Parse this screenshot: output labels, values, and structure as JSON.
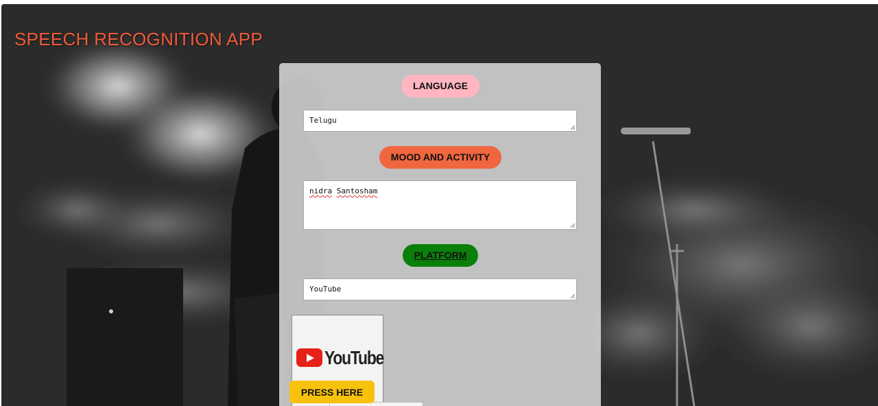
{
  "header": {
    "title": "SPEECH RECOGNITION APP"
  },
  "form": {
    "language_label": "LANGUAGE",
    "language_value": "Telugu",
    "mood_label": "MOOD AND ACTIVITY",
    "mood_value_words": [
      "nidra",
      "Santosham"
    ],
    "platform_label": "PLATFORM",
    "platform_value": "YouTube"
  },
  "platform_logo": {
    "icon": "youtube-logo-icon",
    "text": "YouTube"
  },
  "actions": {
    "press_label": "PRESS HERE"
  },
  "colors": {
    "title": "#f05a38",
    "language_pill": "#ffb6c1",
    "mood_pill": "#f0663e",
    "platform_pill": "#0a7f0a",
    "press_button": "#f7c10c",
    "youtube_red": "#e62117",
    "spellcheck_underline": "#e03030"
  }
}
